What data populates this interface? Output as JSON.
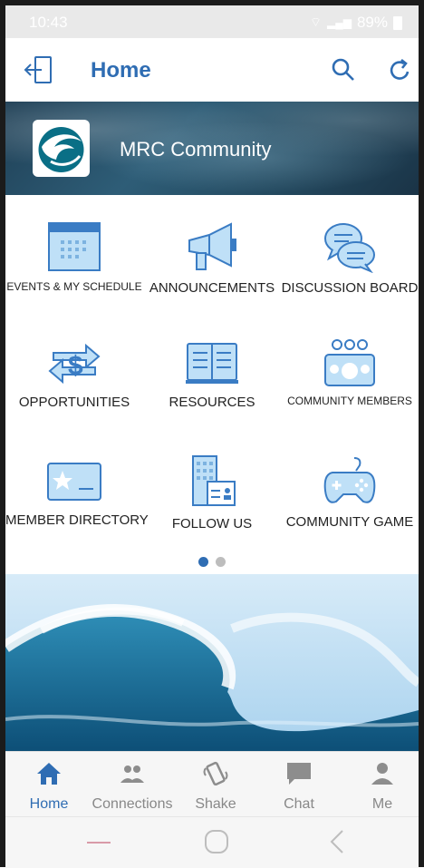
{
  "status_bar": {
    "time": "10:43",
    "battery": "89%"
  },
  "app_bar": {
    "title": "Home"
  },
  "banner": {
    "community_name": "MRC Community"
  },
  "grid": {
    "items": [
      {
        "label": "EVENTS & MY SCHEDULE",
        "icon": "calendar-icon"
      },
      {
        "label": "ANNOUNCEMENTS",
        "icon": "megaphone-icon"
      },
      {
        "label": "DISCUSSION BOARD",
        "icon": "chat-bubbles-icon"
      },
      {
        "label": "OPPORTUNITIES",
        "icon": "dollar-exchange-icon"
      },
      {
        "label": "RESOURCES",
        "icon": "document-icon"
      },
      {
        "label": "COMMUNITY MEMBERS",
        "icon": "group-icon"
      },
      {
        "label": "MEMBER DIRECTORY",
        "icon": "id-card-icon"
      },
      {
        "label": "FOLLOW US",
        "icon": "building-icon"
      },
      {
        "label": "COMMUNITY GAME",
        "icon": "gamepad-icon"
      }
    ]
  },
  "page_indicator": {
    "active": 1,
    "total": 2
  },
  "bottom_nav": {
    "items": [
      {
        "label": "Home",
        "icon": "home-icon",
        "active": true
      },
      {
        "label": "Connections",
        "icon": "people-icon",
        "active": false
      },
      {
        "label": "Shake",
        "icon": "shake-phone-icon",
        "active": false
      },
      {
        "label": "Chat",
        "icon": "chat-icon",
        "active": false
      },
      {
        "label": "Me",
        "icon": "person-icon",
        "active": false
      }
    ]
  },
  "colors": {
    "accent": "#2f6db3",
    "icon_fill": "#bfe0f7",
    "icon_stroke": "#3a7cc4"
  }
}
